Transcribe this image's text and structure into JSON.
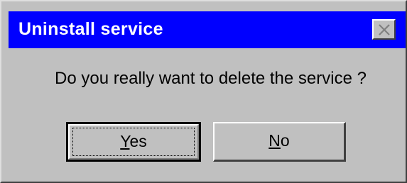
{
  "window": {
    "title": "Uninstall service",
    "close_icon": "close-icon"
  },
  "message": "Do you really want to delete the service ?",
  "buttons": {
    "yes": {
      "mnemonic": "Y",
      "rest": "es"
    },
    "no": {
      "mnemonic": "N",
      "rest": "o"
    }
  },
  "colors": {
    "titlebar": "#0000ff",
    "face": "#c0c0c0",
    "title_text": "#ffffff"
  }
}
